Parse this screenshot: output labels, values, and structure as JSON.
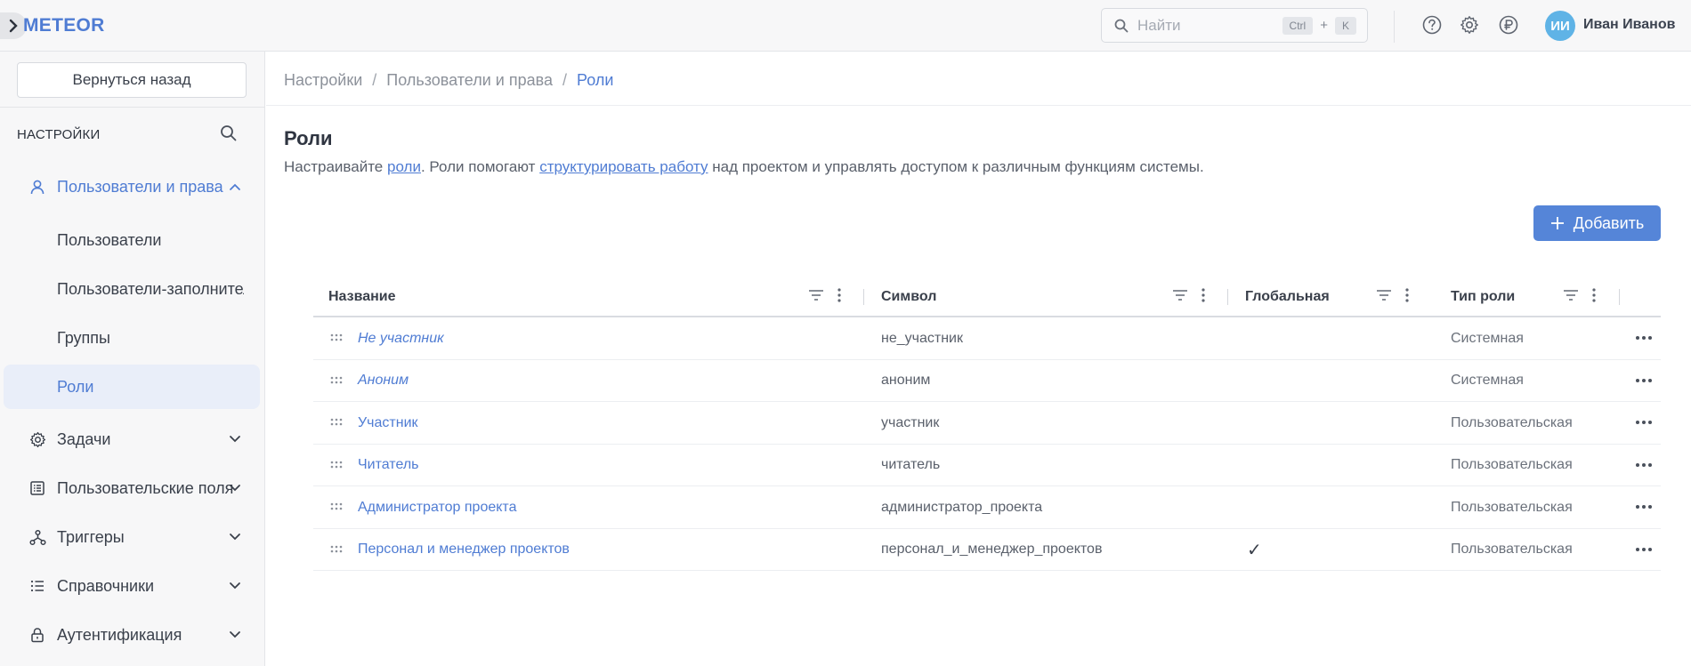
{
  "app": {
    "logo": "METEOR"
  },
  "topbar": {
    "search_placeholder": "Найти",
    "kbd_ctrl": "Ctrl",
    "kbd_plus": "+",
    "kbd_k": "K",
    "user_initials": "ИИ",
    "user_name": "Иван Иванов",
    "avatar_color": "#5fb3e6"
  },
  "sidebar": {
    "back_label": "Вернуться назад",
    "heading": "НАСТРОЙКИ",
    "group_users": "Пользователи и права",
    "sub_items": [
      "Пользователи",
      "Пользователи-заполнители",
      "Группы",
      "Роли"
    ],
    "items": [
      "Задачи",
      "Пользовательские поля",
      "Триггеры",
      "Справочники",
      "Аутентификация"
    ]
  },
  "breadcrumb": {
    "items": [
      "Настройки",
      "Пользователи и права"
    ],
    "current": "Роли",
    "separator": "/"
  },
  "page": {
    "title": "Роли",
    "desc_prefix": "Настраивайте ",
    "desc_link1": "роли",
    "desc_middle": ". Роли помогают ",
    "desc_link2": "структурировать работу",
    "desc_suffix": " над проектом и управлять доступом к различным функциям системы.",
    "add_label": "Добавить"
  },
  "table": {
    "columns": [
      "Название",
      "Символ",
      "Глобальная",
      "Тип роли"
    ],
    "rows": [
      {
        "name": "Не участник",
        "symbol": "не_участник",
        "global": "",
        "type": "Системная",
        "italic": true
      },
      {
        "name": "Аноним",
        "symbol": "аноним",
        "global": "",
        "type": "Системная",
        "italic": true
      },
      {
        "name": "Участник",
        "symbol": "участник",
        "global": "",
        "type": "Пользовательская",
        "italic": false
      },
      {
        "name": "Читатель",
        "symbol": "читатель",
        "global": "",
        "type": "Пользовательская",
        "italic": false
      },
      {
        "name": "Администратор проекта",
        "symbol": "администратор_проекта",
        "global": "",
        "type": "Пользовательская",
        "italic": false
      },
      {
        "name": "Персонал и менеджер проектов",
        "symbol": "персонал_и_менеджер_проектов",
        "global": "✓",
        "type": "Пользовательская",
        "italic": false
      }
    ]
  },
  "colors": {
    "accent": "#4f7cd3",
    "button": "#5585d8",
    "selected_bg": "#e9eef9"
  }
}
